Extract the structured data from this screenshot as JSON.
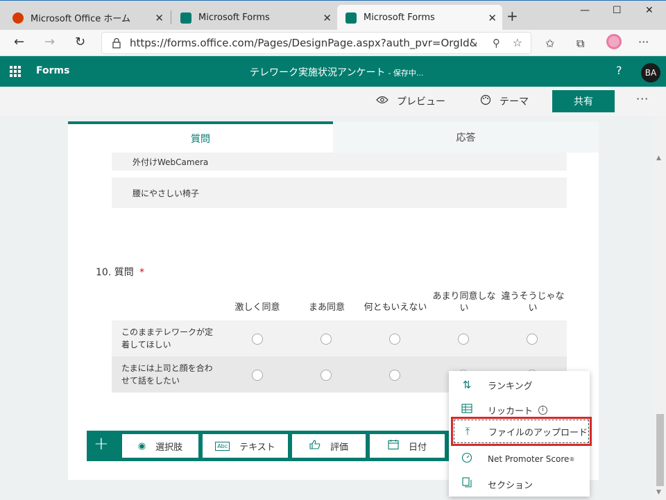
{
  "browser": {
    "tabs": [
      {
        "title": "Microsoft Office ホーム"
      },
      {
        "title": "Microsoft Forms"
      },
      {
        "title": "Microsoft Forms"
      }
    ],
    "url": "https://forms.office.com/Pages/DesignPage.aspx?auth_pvr=OrgId&a..."
  },
  "header": {
    "app_name": "Forms",
    "form_title": "テレワーク実施状況アンケート",
    "status": "- 保存中...",
    "help": "?",
    "avatar": "BA"
  },
  "commands": {
    "preview": "プレビュー",
    "theme": "テーマ",
    "share": "共有",
    "more": "···"
  },
  "tabs": {
    "questions": "質問",
    "responses": "応答"
  },
  "previous_options": [
    "外付けWebCamera",
    "腰にやさしい椅子"
  ],
  "question": {
    "number": "10.",
    "title": "質問",
    "required_mark": "*",
    "columns": [
      "激しく同意",
      "まあ同意",
      "何ともいえない",
      "あまり同意しない",
      "違うそうじゃない"
    ],
    "statements": [
      "このままテレワークが定着してほしい",
      "たまには上司と顔を合わせて話をしたい"
    ]
  },
  "toolbar": {
    "add": "+",
    "buttons": [
      "選択肢",
      "テキスト",
      "評価",
      "日付"
    ]
  },
  "dropdown": {
    "items": [
      "ランキング",
      "リッカート",
      "ファイルのアップロード",
      "Net Promoter Score",
      "セクション"
    ],
    "info_mark": "i",
    "registered_mark": "®"
  },
  "colors": {
    "brand": "#037c6e",
    "highlight": "#d42a2a",
    "required": "#c50f1f"
  }
}
